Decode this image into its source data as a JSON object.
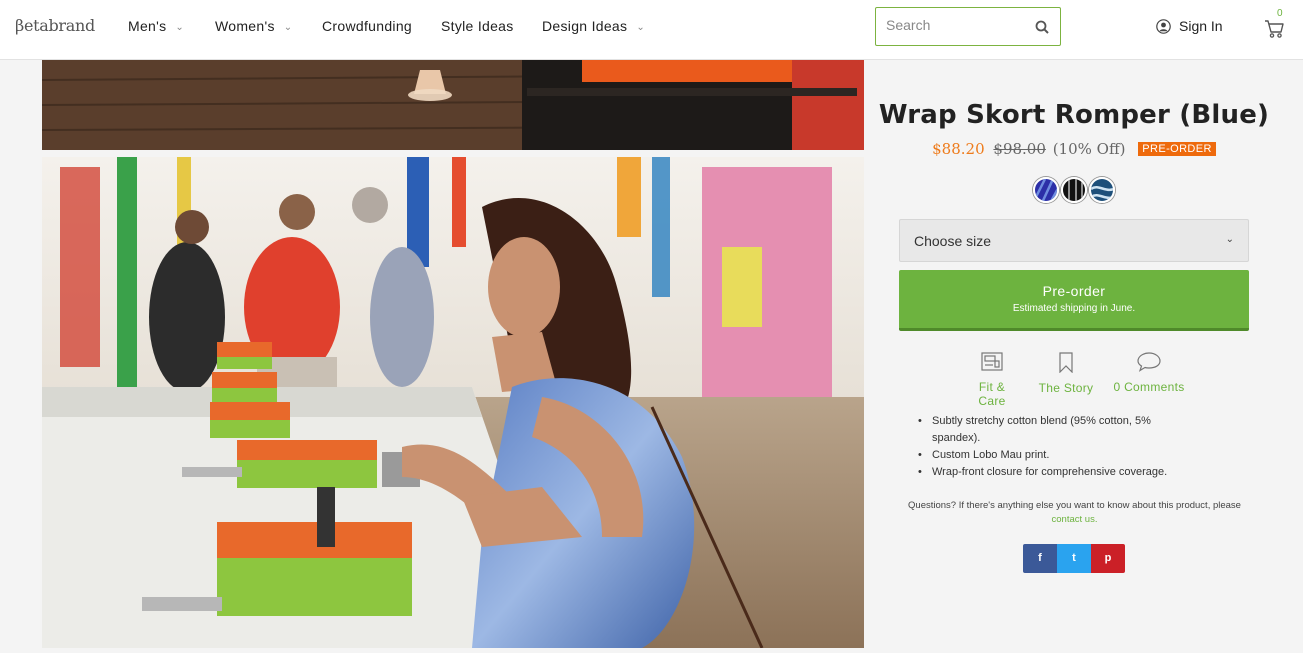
{
  "header": {
    "logo": "βetabrand",
    "nav": [
      {
        "label": "Men's",
        "has_dropdown": true
      },
      {
        "label": "Women's",
        "has_dropdown": true
      },
      {
        "label": "Crowdfunding",
        "has_dropdown": false
      },
      {
        "label": "Style Ideas",
        "has_dropdown": false
      },
      {
        "label": "Design Ideas",
        "has_dropdown": true
      }
    ],
    "search_placeholder": "Search",
    "sign_in": "Sign In",
    "cart_count": "0",
    "accent_color": "#6db33f"
  },
  "product": {
    "title": "Wrap Skort Romper (Blue)",
    "price_sale": "$88.20",
    "price_original": "$98.00",
    "discount": "(10% Off)",
    "badge": "PRE-ORDER",
    "swatches": [
      "blue-print",
      "black-print",
      "ocean-print"
    ],
    "size_select": "Choose size",
    "preorder_button": "Pre-order",
    "shipping_note": "Estimated shipping in June.",
    "tabs": [
      {
        "label": "Fit & Care",
        "icon": "sewing-machine-icon"
      },
      {
        "label": "The Story",
        "icon": "bookmark-icon"
      },
      {
        "label": "0 Comments",
        "icon": "speech-bubble-icon"
      }
    ],
    "features": [
      "Subtly stretchy cotton blend (95% cotton, 5% spandex).",
      "Custom Lobo Mau print.",
      "Wrap-front closure for comprehensive coverage."
    ],
    "questions_text": "Questions? If there's anything else you want to know about this product, please",
    "contact_link": "contact us.",
    "share": [
      "f",
      "t",
      "p"
    ],
    "share_colors": [
      "#3b5998",
      "#2aa3ef",
      "#cb2027"
    ]
  }
}
